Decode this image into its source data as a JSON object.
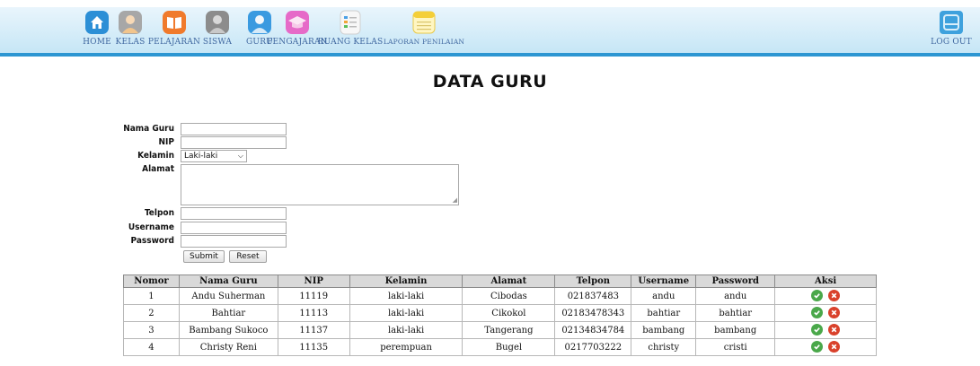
{
  "nav": {
    "items": [
      {
        "label": "HOME",
        "icon": "home-icon"
      },
      {
        "label": "KELAS",
        "icon": "person-icon"
      },
      {
        "label": "PELAJARAN",
        "icon": "book-icon"
      },
      {
        "label": "SISWA",
        "icon": "student-icon"
      },
      {
        "label": "GURU",
        "icon": "teacher-icon"
      },
      {
        "label": "PENGAJARAN",
        "icon": "graduation-cap-icon"
      },
      {
        "label": "RUANG KELAS",
        "icon": "list-icon"
      },
      {
        "label": "LAPORAN PENILAIAN",
        "icon": "notepad-icon"
      }
    ],
    "logout_label": "LOG OUT",
    "accent": "#2d96d2"
  },
  "page_title": "DATA GURU",
  "form": {
    "labels": {
      "nama": "Nama Guru",
      "nip": "NIP",
      "kelamin": "Kelamin",
      "alamat": "Alamat",
      "telpon": "Telpon",
      "username": "Username",
      "password": "Password"
    },
    "kelamin_selected": "Laki-laki",
    "submit_label": "Submit",
    "reset_label": "Reset"
  },
  "table": {
    "headers": [
      "Nomor",
      "Nama Guru",
      "NIP",
      "Kelamin",
      "Alamat",
      "Telpon",
      "Username",
      "Password",
      "Aksi"
    ],
    "rows": [
      [
        "1",
        "Andu Suherman",
        "11119",
        "laki-laki",
        "Cibodas",
        "021837483",
        "andu",
        "andu"
      ],
      [
        "2",
        "Bahtiar",
        "11113",
        "laki-laki",
        "Cikokol",
        "02183478343",
        "bahtiar",
        "bahtiar"
      ],
      [
        "3",
        "Bambang Sukoco",
        "11137",
        "laki-laki",
        "Tangerang",
        "02134834784",
        "bambang",
        "bambang"
      ],
      [
        "4",
        "Christy Reni",
        "11135",
        "perempuan",
        "Bugel",
        "0217703222",
        "christy",
        "cristi"
      ]
    ]
  }
}
